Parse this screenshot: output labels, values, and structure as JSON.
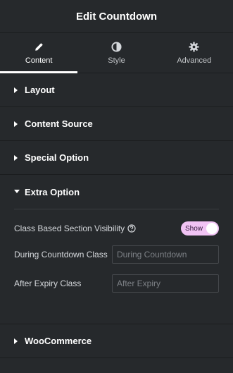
{
  "header": {
    "title": "Edit Countdown"
  },
  "tabs": [
    {
      "label": "Content",
      "icon": "pencil-icon",
      "active": true
    },
    {
      "label": "Style",
      "icon": "half-circle-icon",
      "active": false
    },
    {
      "label": "Advanced",
      "icon": "gear-icon",
      "active": false
    }
  ],
  "sections": {
    "layout": {
      "title": "Layout"
    },
    "content_source": {
      "title": "Content Source"
    },
    "special_option": {
      "title": "Special Option"
    },
    "extra_option": {
      "title": "Extra Option",
      "class_visibility_label": "Class Based Section Visibility",
      "toggle_label": "Show",
      "toggle_on": true,
      "during_label": "During Countdown Class",
      "during_placeholder": "During Countdown",
      "after_label": "After Expiry Class",
      "after_placeholder": "After Expiry"
    },
    "woocommerce": {
      "title": "WooCommerce"
    }
  },
  "colors": {
    "background": "#26292c",
    "toggle_on": "#f1c3f4",
    "active_tab_indicator": "#ffffff"
  }
}
